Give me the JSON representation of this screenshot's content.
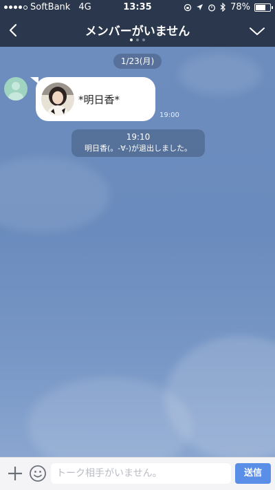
{
  "status_bar": {
    "carrier": "SoftBank",
    "network": "4G",
    "time": "13:35",
    "battery_percent": "78%",
    "battery_level": 0.78,
    "signal_bars_filled": 4
  },
  "header": {
    "title": "メンバーがいません",
    "page_count": 3,
    "active_page": 0
  },
  "chat": {
    "date_label": "1/23(月)",
    "messages": [
      {
        "type": "incoming",
        "text": "*明日香*",
        "time": "19:00"
      }
    ],
    "system_message": {
      "time": "19:10",
      "text": "明日香(。-∀-)が退出しました。"
    }
  },
  "input_bar": {
    "placeholder": "トーク相手がいません。",
    "send_label": "送信"
  },
  "colors": {
    "header_bg": "#2a374d",
    "chat_bg": "#6d8dbe",
    "send_button": "#5b8ee6",
    "avatar_default": "#9fd4c1"
  }
}
